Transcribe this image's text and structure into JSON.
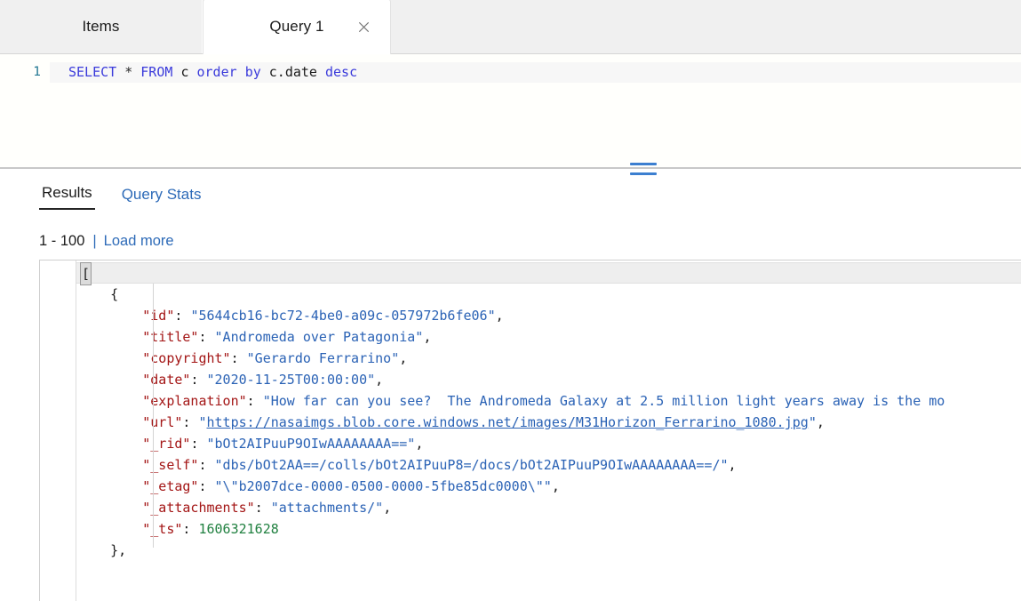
{
  "tabs": [
    {
      "label": "Items",
      "active": false,
      "closable": false
    },
    {
      "label": "Query 1",
      "active": true,
      "closable": true
    }
  ],
  "editor": {
    "line_number": "1",
    "tokens": [
      {
        "t": "SELECT",
        "c": "kw"
      },
      {
        "t": " ",
        "c": "ws"
      },
      {
        "t": "*",
        "c": "op"
      },
      {
        "t": " ",
        "c": "ws"
      },
      {
        "t": "FROM",
        "c": "kw"
      },
      {
        "t": " ",
        "c": "ws"
      },
      {
        "t": "c",
        "c": "ident"
      },
      {
        "t": " ",
        "c": "ws"
      },
      {
        "t": "order",
        "c": "kw"
      },
      {
        "t": " ",
        "c": "ws"
      },
      {
        "t": "by",
        "c": "kw"
      },
      {
        "t": " ",
        "c": "ws"
      },
      {
        "t": "c.date",
        "c": "ident"
      },
      {
        "t": " ",
        "c": "ws"
      },
      {
        "t": "desc",
        "c": "kw"
      }
    ],
    "query_text": "SELECT * FROM c order by c.date desc"
  },
  "splitter": {
    "grip_icon": "horizontal-grip-icon"
  },
  "results": {
    "tabs": [
      {
        "label": "Results",
        "selected": true
      },
      {
        "label": "Query Stats",
        "selected": false
      }
    ],
    "range": "1 - 100",
    "separator": "|",
    "load_more": "Load more"
  },
  "json_result": {
    "lines": [
      {
        "indent": 0,
        "segments": [
          {
            "t": "[",
            "c": "selbox"
          }
        ],
        "current": true
      },
      {
        "indent": 1,
        "segments": [
          {
            "t": "{",
            "c": "punc"
          }
        ]
      },
      {
        "indent": 2,
        "segments": [
          {
            "t": "\"id\"",
            "c": "key"
          },
          {
            "t": ": ",
            "c": "punc"
          },
          {
            "t": "\"5644cb16-bc72-4be0-a09c-057972b6fe06\"",
            "c": "str"
          },
          {
            "t": ",",
            "c": "punc"
          }
        ]
      },
      {
        "indent": 2,
        "segments": [
          {
            "t": "\"title\"",
            "c": "key"
          },
          {
            "t": ": ",
            "c": "punc"
          },
          {
            "t": "\"Andromeda over Patagonia\"",
            "c": "str"
          },
          {
            "t": ",",
            "c": "punc"
          }
        ]
      },
      {
        "indent": 2,
        "segments": [
          {
            "t": "\"copyright\"",
            "c": "key"
          },
          {
            "t": ": ",
            "c": "punc"
          },
          {
            "t": "\"Gerardo Ferrarino\"",
            "c": "str"
          },
          {
            "t": ",",
            "c": "punc"
          }
        ]
      },
      {
        "indent": 2,
        "segments": [
          {
            "t": "\"date\"",
            "c": "key"
          },
          {
            "t": ": ",
            "c": "punc"
          },
          {
            "t": "\"2020-11-25T00:00:00\"",
            "c": "str"
          },
          {
            "t": ",",
            "c": "punc"
          }
        ]
      },
      {
        "indent": 2,
        "segments": [
          {
            "t": "\"explanation\"",
            "c": "key"
          },
          {
            "t": ": ",
            "c": "punc"
          },
          {
            "t": "\"How far can you see?  The Andromeda Galaxy at 2.5 million light years away is the mo",
            "c": "str"
          }
        ]
      },
      {
        "indent": 2,
        "segments": [
          {
            "t": "\"url\"",
            "c": "key"
          },
          {
            "t": ": ",
            "c": "punc"
          },
          {
            "t": "\"",
            "c": "str"
          },
          {
            "t": "https://nasaimgs.blob.core.windows.net/images/M31Horizon_Ferrarino_1080.jpg",
            "c": "link"
          },
          {
            "t": "\"",
            "c": "str"
          },
          {
            "t": ",",
            "c": "punc"
          }
        ]
      },
      {
        "indent": 2,
        "segments": [
          {
            "t": "\"_rid\"",
            "c": "key"
          },
          {
            "t": ": ",
            "c": "punc"
          },
          {
            "t": "\"bOt2AIPuuP9OIwAAAAAAAA==\"",
            "c": "str"
          },
          {
            "t": ",",
            "c": "punc"
          }
        ]
      },
      {
        "indent": 2,
        "segments": [
          {
            "t": "\"_self\"",
            "c": "key"
          },
          {
            "t": ": ",
            "c": "punc"
          },
          {
            "t": "\"dbs/bOt2AA==/colls/bOt2AIPuuP8=/docs/bOt2AIPuuP9OIwAAAAAAAA==/\"",
            "c": "str"
          },
          {
            "t": ",",
            "c": "punc"
          }
        ]
      },
      {
        "indent": 2,
        "segments": [
          {
            "t": "\"_etag\"",
            "c": "key"
          },
          {
            "t": ": ",
            "c": "punc"
          },
          {
            "t": "\"\\\"b2007dce-0000-0500-0000-5fbe85dc0000\\\"\"",
            "c": "str"
          },
          {
            "t": ",",
            "c": "punc"
          }
        ]
      },
      {
        "indent": 2,
        "segments": [
          {
            "t": "\"_attachments\"",
            "c": "key"
          },
          {
            "t": ": ",
            "c": "punc"
          },
          {
            "t": "\"attachments/\"",
            "c": "str"
          },
          {
            "t": ",",
            "c": "punc"
          }
        ]
      },
      {
        "indent": 2,
        "segments": [
          {
            "t": "\"_ts\"",
            "c": "key"
          },
          {
            "t": ": ",
            "c": "punc"
          },
          {
            "t": "1606321628",
            "c": "num"
          }
        ]
      },
      {
        "indent": 1,
        "segments": [
          {
            "t": "},",
            "c": "punc"
          }
        ]
      }
    ]
  },
  "colors": {
    "tabstrip_bg": "#f0f0f0",
    "active_tab_bg": "#ffffff",
    "link_blue": "#2e6bb8",
    "keyword_blue": "#3b3bdb",
    "json_key": "#a31515",
    "json_string": "#2a62b5",
    "json_number": "#208040",
    "splitter_grip": "#3c7fd0"
  }
}
